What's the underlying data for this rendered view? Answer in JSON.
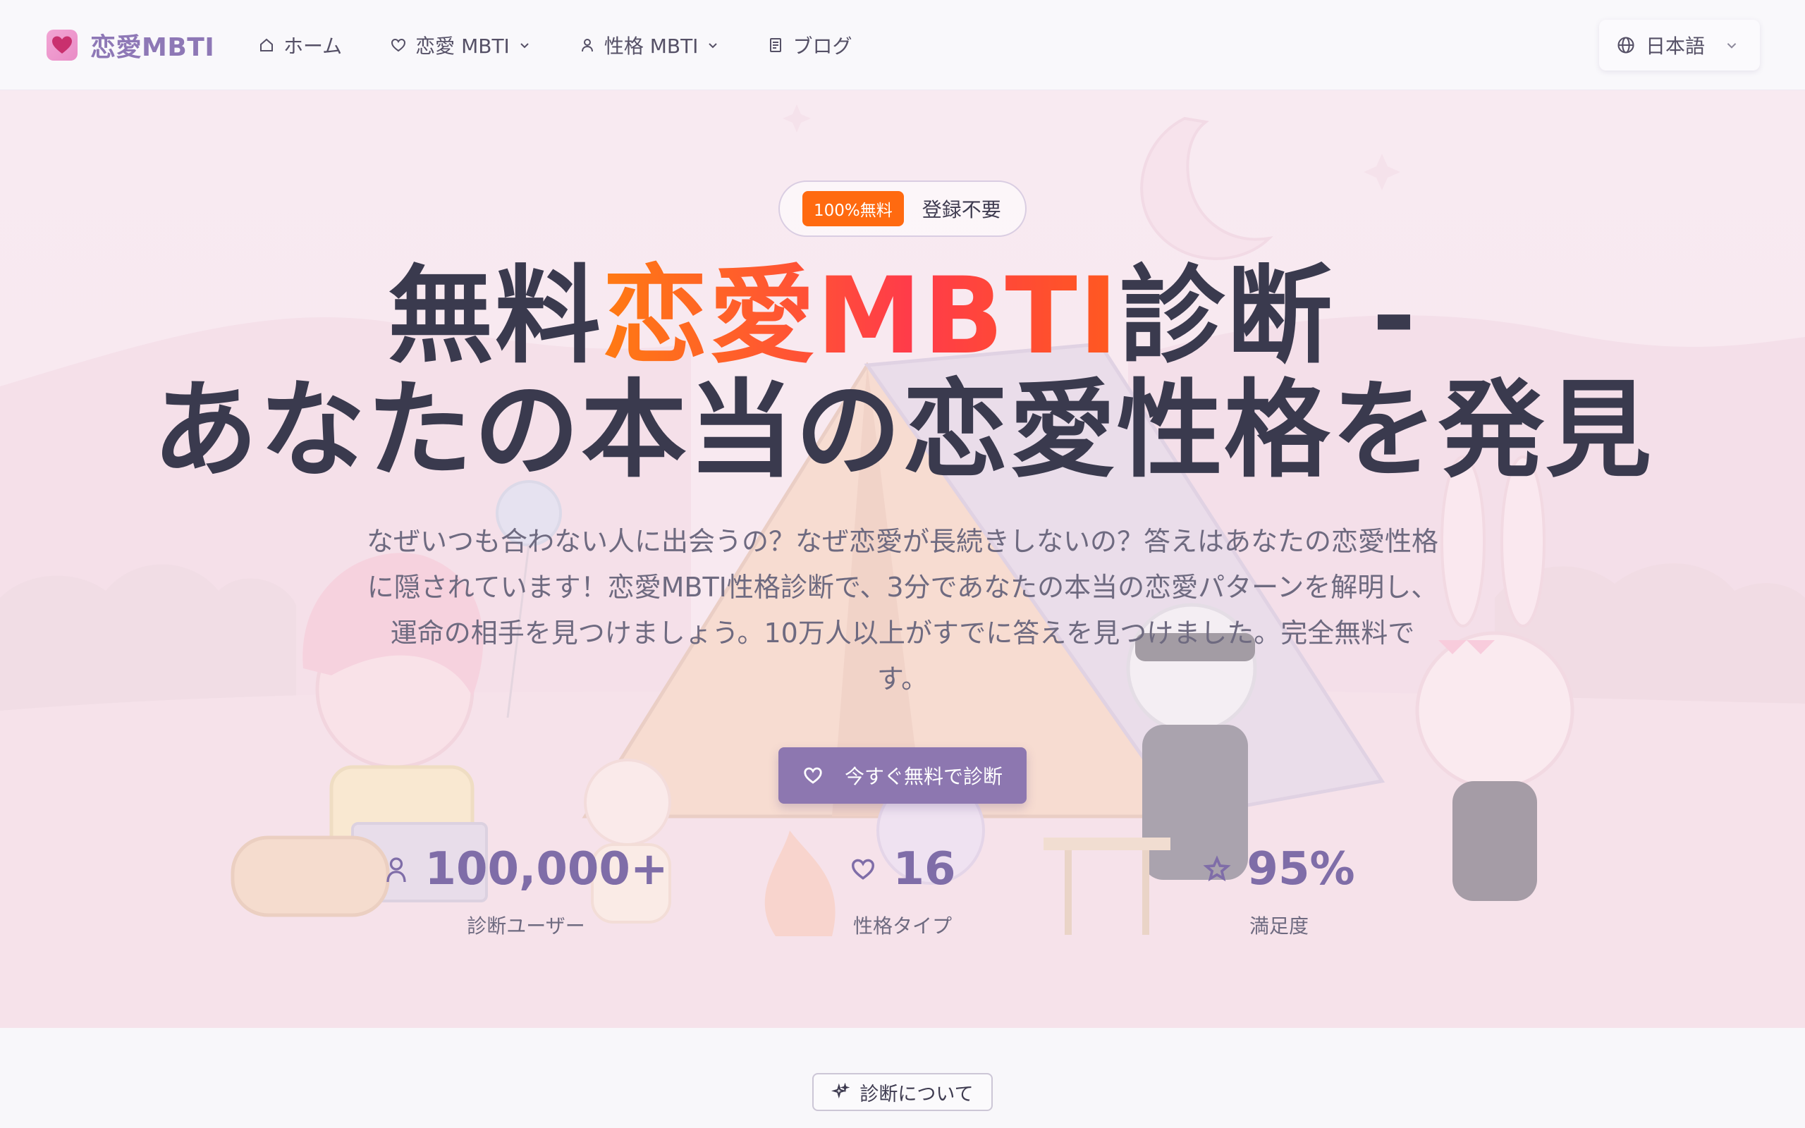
{
  "header": {
    "brand": "恋愛MBTI",
    "nav": [
      {
        "label": "ホーム",
        "icon": "home-icon"
      },
      {
        "label": "恋愛 MBTI",
        "icon": "heart-icon",
        "dropdown": true
      },
      {
        "label": "性格 MBTI",
        "icon": "user-icon",
        "dropdown": true
      },
      {
        "label": "ブログ",
        "icon": "document-icon"
      }
    ],
    "language": "日本語"
  },
  "hero": {
    "badge_pill": "100%無料",
    "badge_text": "登録不要",
    "title_pre": "無料",
    "title_accent": "恋愛MBTI",
    "title_post": "診断 -",
    "title_line2": "あなたの本当の恋愛性格を発見",
    "description": "なぜいつも合わない人に出会うの？なぜ恋愛が長続きしないの？答えはあなたの恋愛性格に隠されています！恋愛MBTI性格診断で、3分であなたの本当の恋愛パターンを解明し、運命の相手を見つけましょう。10万人以上がすでに答えを見つけました。完全無料です。",
    "cta": "今すぐ無料で診断",
    "stats": [
      {
        "value": "100,000+",
        "label": "診断ユーザー",
        "icon": "user-icon"
      },
      {
        "value": "16",
        "label": "性格タイプ",
        "icon": "heart-icon"
      },
      {
        "value": "95%",
        "label": "満足度",
        "icon": "star-icon"
      }
    ]
  },
  "about": {
    "tag": "診断について"
  },
  "colors": {
    "brand": "#8e78b6",
    "accent_orange": "#ff6a10",
    "accent_red": "#ff3b4a",
    "cta": "#8d77b0"
  }
}
